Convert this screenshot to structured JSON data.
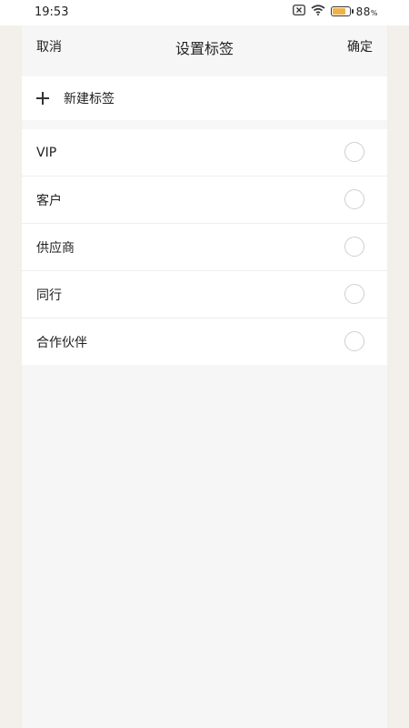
{
  "status_bar": {
    "time": "19:53",
    "battery_level": "88",
    "battery_unit": "%",
    "battery_fraction": 0.88,
    "battery_color": "#f0b14a",
    "icons": [
      "sim-x-icon",
      "wifi-icon",
      "battery-icon"
    ]
  },
  "header": {
    "cancel_label": "取消",
    "title": "设置标签",
    "confirm_label": "确定"
  },
  "new_tag": {
    "icon": "plus-icon",
    "label": "新建标签"
  },
  "tags": [
    {
      "label": "VIP",
      "checked": false
    },
    {
      "label": "客户",
      "checked": false
    },
    {
      "label": "供应商",
      "checked": false
    },
    {
      "label": "同行",
      "checked": false
    },
    {
      "label": "合作伙伴",
      "checked": false
    }
  ]
}
